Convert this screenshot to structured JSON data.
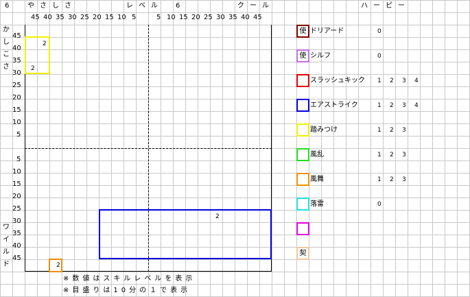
{
  "header": {
    "left_value": "6",
    "yasashisa": "やさしさ",
    "level_label": "レベル",
    "right_value": "6",
    "cool": "クール",
    "harpy": "ハーピー"
  },
  "axis_top": [
    "45",
    "40",
    "35",
    "30",
    "25",
    "20",
    "15",
    "10",
    "5",
    "",
    "5",
    "10",
    "15",
    "20",
    "25",
    "30",
    "35",
    "40",
    "45"
  ],
  "axis_left": [
    "45",
    "40",
    "35",
    "30",
    "25",
    "20",
    "15",
    "10",
    "5",
    "",
    "5",
    "10",
    "15",
    "20",
    "25",
    "30",
    "35",
    "40",
    "45"
  ],
  "side_label_top": [
    "か",
    "し",
    "こ",
    "さ"
  ],
  "side_label_bottom": [
    "ワ",
    "イ",
    "ル",
    "ド"
  ],
  "chart_marks": [
    {
      "label": "2"
    },
    {
      "label": "2"
    },
    {
      "label": "2"
    },
    {
      "label": "2"
    }
  ],
  "notes": [
    "※数値はスキルレベルを表示",
    "※目盛りは10分の１で表示"
  ],
  "legend": [
    {
      "name": "ドリアード",
      "icon_text": "使",
      "color": "#7a0000",
      "levels": [
        "0"
      ]
    },
    {
      "name": "シルフ",
      "icon_text": "使",
      "color": "#c070e0",
      "levels": [
        "0"
      ]
    },
    {
      "name": "スラッシュキック",
      "icon_text": "",
      "color": "#e00000",
      "levels": [
        "1",
        "2",
        "3",
        "4"
      ]
    },
    {
      "name": "エアストライク",
      "icon_text": "",
      "color": "#0000e0",
      "levels": [
        "1",
        "2",
        "3",
        "4"
      ]
    },
    {
      "name": "踏みつけ",
      "icon_text": "",
      "color": "#f0f000",
      "levels": [
        "1",
        "2",
        "3"
      ]
    },
    {
      "name": "風乱",
      "icon_text": "",
      "color": "#20e020",
      "levels": [
        "1",
        "2",
        "3"
      ]
    },
    {
      "name": "風舞",
      "icon_text": "",
      "color": "#f09000",
      "levels": [
        "1",
        "2",
        "3"
      ]
    },
    {
      "name": "落雷",
      "icon_text": "",
      "color": "#20e0e0",
      "levels": [
        "0"
      ]
    },
    {
      "name": "",
      "icon_text": "",
      "color": "#e000e0",
      "levels": []
    },
    {
      "name": "",
      "icon_text": "契",
      "color": "#f0c8a0",
      "levels": []
    }
  ]
}
